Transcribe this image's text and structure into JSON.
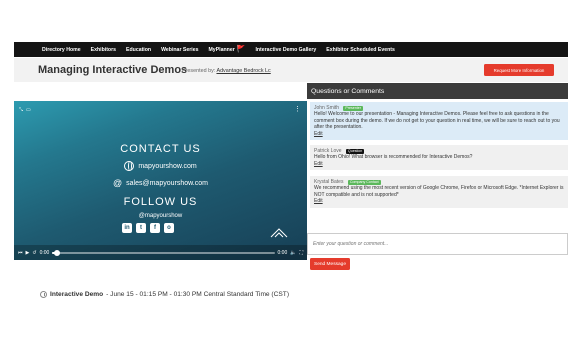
{
  "nav": {
    "items": [
      {
        "label": "Directory Home"
      },
      {
        "label": "Exhibitors"
      },
      {
        "label": "Education"
      },
      {
        "label": "Webinar Series"
      },
      {
        "label": "MyPlanner",
        "icon": "flag-emoji"
      },
      {
        "label": "Interactive Demo Gallery"
      },
      {
        "label": "Exhibitor Scheduled Events"
      }
    ]
  },
  "header": {
    "title": "Managing Interactive Demos",
    "presented_prefix": "Presented by:",
    "presenter_link": "Advantage Bedrock Lc",
    "request_button": "Request More Information"
  },
  "video": {
    "contact_title": "CONTACT US",
    "website": "mapyourshow.com",
    "email": "sales@mapyourshow.com",
    "follow_title": "FOLLOW US",
    "handle": "@mapyourshow",
    "socials": [
      "in",
      "t",
      "f",
      "o"
    ],
    "time_current": "0:00",
    "time_end": "0:00",
    "progress": 0.02
  },
  "qa": {
    "title": "Questions or Comments",
    "messages": [
      {
        "name": "John Smith",
        "badge": "Presenter",
        "text": "Hello! Welcome to our presentation - Managing Interactive Demos. Please feel free to ask questions in the comment box during the demo. If we do not get to your question in real time, we will be sure to reach out to you after the presentation.",
        "edit": "Edit",
        "bg": "#dcebf7"
      },
      {
        "name": "Patrick Love",
        "badge": "Question",
        "text": "Hello from Ohio! What browser is recommended for Interactive Demos?",
        "edit": "Edit",
        "bg": "#f0f0f0"
      },
      {
        "name": "Krystal Bates",
        "badge": "Company Contact",
        "text": "We recommend using the most recent version of Google Chrome, Firefox or Microsoft Edge. *Internet Explorer is NOT compatible and is not supported*",
        "edit": "Edit",
        "bg": "#f0f0f0"
      }
    ],
    "input_placeholder": "Enter your question or comment...",
    "send_button": "Send Message"
  },
  "event": {
    "name": "Interactive Demo",
    "details": "- June 15 - 01:15 PM - 01:30 PM Central Standard Time (CST)"
  },
  "colors": {
    "accent": "#e53b2c",
    "nav_bg": "#141414",
    "qa_header_bg": "#3b3b3b"
  }
}
